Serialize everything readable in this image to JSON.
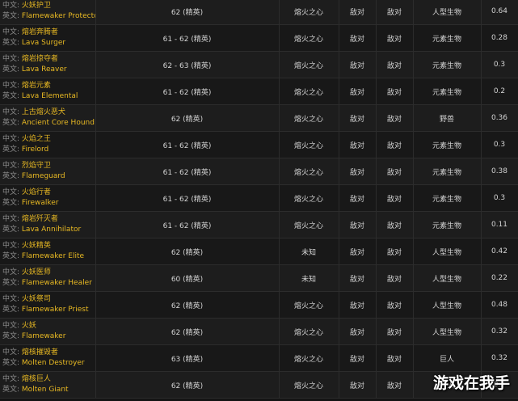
{
  "labels": {
    "zh": "中文:",
    "en": "英文:"
  },
  "rows": [
    {
      "zh": "火妖护卫",
      "en": "Flamewaker Protector",
      "level": "62 (精英)",
      "faction": "熔火之心",
      "react_a": "敌对",
      "react_h": "敌对",
      "type": "人型生物",
      "value": "0.64"
    },
    {
      "zh": "熔岩奔腾者",
      "en": "Lava Surger",
      "level": "61 - 62 (精英)",
      "faction": "熔火之心",
      "react_a": "敌对",
      "react_h": "敌对",
      "type": "元素生物",
      "value": "0.28"
    },
    {
      "zh": "熔岩掠夺者",
      "en": "Lava Reaver",
      "level": "62 - 63 (精英)",
      "faction": "熔火之心",
      "react_a": "敌对",
      "react_h": "敌对",
      "type": "元素生物",
      "value": "0.3"
    },
    {
      "zh": "熔岩元素",
      "en": "Lava Elemental",
      "level": "61 - 62 (精英)",
      "faction": "熔火之心",
      "react_a": "敌对",
      "react_h": "敌对",
      "type": "元素生物",
      "value": "0.2"
    },
    {
      "zh": "上古熔火恶犬",
      "en": "Ancient Core Hound",
      "level": "62 (精英)",
      "faction": "熔火之心",
      "react_a": "敌对",
      "react_h": "敌对",
      "type": "野兽",
      "value": "0.36"
    },
    {
      "zh": "火焰之王",
      "en": "Firelord",
      "level": "61 - 62 (精英)",
      "faction": "熔火之心",
      "react_a": "敌对",
      "react_h": "敌对",
      "type": "元素生物",
      "value": "0.3"
    },
    {
      "zh": "烈焰守卫",
      "en": "Flameguard",
      "level": "61 - 62 (精英)",
      "faction": "熔火之心",
      "react_a": "敌对",
      "react_h": "敌对",
      "type": "元素生物",
      "value": "0.38"
    },
    {
      "zh": "火焰行者",
      "en": "Firewalker",
      "level": "61 - 62 (精英)",
      "faction": "熔火之心",
      "react_a": "敌对",
      "react_h": "敌对",
      "type": "元素生物",
      "value": "0.3"
    },
    {
      "zh": "熔岩歼灭者",
      "en": "Lava Annihilator",
      "level": "61 - 62 (精英)",
      "faction": "熔火之心",
      "react_a": "敌对",
      "react_h": "敌对",
      "type": "元素生物",
      "value": "0.11"
    },
    {
      "zh": "火妖精英",
      "en": "Flamewaker Elite",
      "level": "62 (精英)",
      "faction": "未知",
      "react_a": "敌对",
      "react_h": "敌对",
      "type": "人型生物",
      "value": "0.42"
    },
    {
      "zh": "火妖医师",
      "en": "Flamewaker Healer",
      "level": "60 (精英)",
      "faction": "未知",
      "react_a": "敌对",
      "react_h": "敌对",
      "type": "人型生物",
      "value": "0.22"
    },
    {
      "zh": "火妖祭司",
      "en": "Flamewaker Priest",
      "level": "62 (精英)",
      "faction": "熔火之心",
      "react_a": "敌对",
      "react_h": "敌对",
      "type": "人型生物",
      "value": "0.48"
    },
    {
      "zh": "火妖",
      "en": "Flamewaker",
      "level": "62 (精英)",
      "faction": "熔火之心",
      "react_a": "敌对",
      "react_h": "敌对",
      "type": "人型生物",
      "value": "0.32"
    },
    {
      "zh": "熔核摧毁者",
      "en": "Molten Destroyer",
      "level": "63 (精英)",
      "faction": "熔火之心",
      "react_a": "敌对",
      "react_h": "敌对",
      "type": "巨人",
      "value": "0.32"
    },
    {
      "zh": "熔核巨人",
      "en": "Molten Giant",
      "level": "62 (精英)",
      "faction": "熔火之心",
      "react_a": "敌对",
      "react_h": "敌对",
      "type": "巨人",
      "value": "0.3"
    }
  ],
  "watermark": "游戏在我手",
  "colors": {
    "name": "#e8b923",
    "hostile": "#e3302d",
    "background": "#141414",
    "row_dark": "#181818",
    "row_light": "#1d1d1d"
  }
}
